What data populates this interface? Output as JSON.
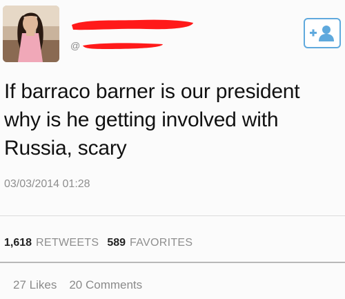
{
  "user": {
    "handle_prefix": "@",
    "avatar_icon": "profile-photo",
    "redaction_color": "#ff1a1a"
  },
  "follow_button": {
    "label": "+",
    "icon": "person-icon",
    "accent_color": "#5fa9dd"
  },
  "tweet": {
    "text_lines": [
      "If barraco barner is our president",
      "why is he getting involved with",
      "Russia, scary"
    ],
    "timestamp": "03/03/2014 01:28"
  },
  "stats": {
    "retweets_count": "1,618",
    "retweets_label": "RETWEETS",
    "favorites_count": "589",
    "favorites_label": "FAVORITES"
  },
  "engagement": {
    "likes": "27 Likes",
    "comments": "20 Comments"
  }
}
